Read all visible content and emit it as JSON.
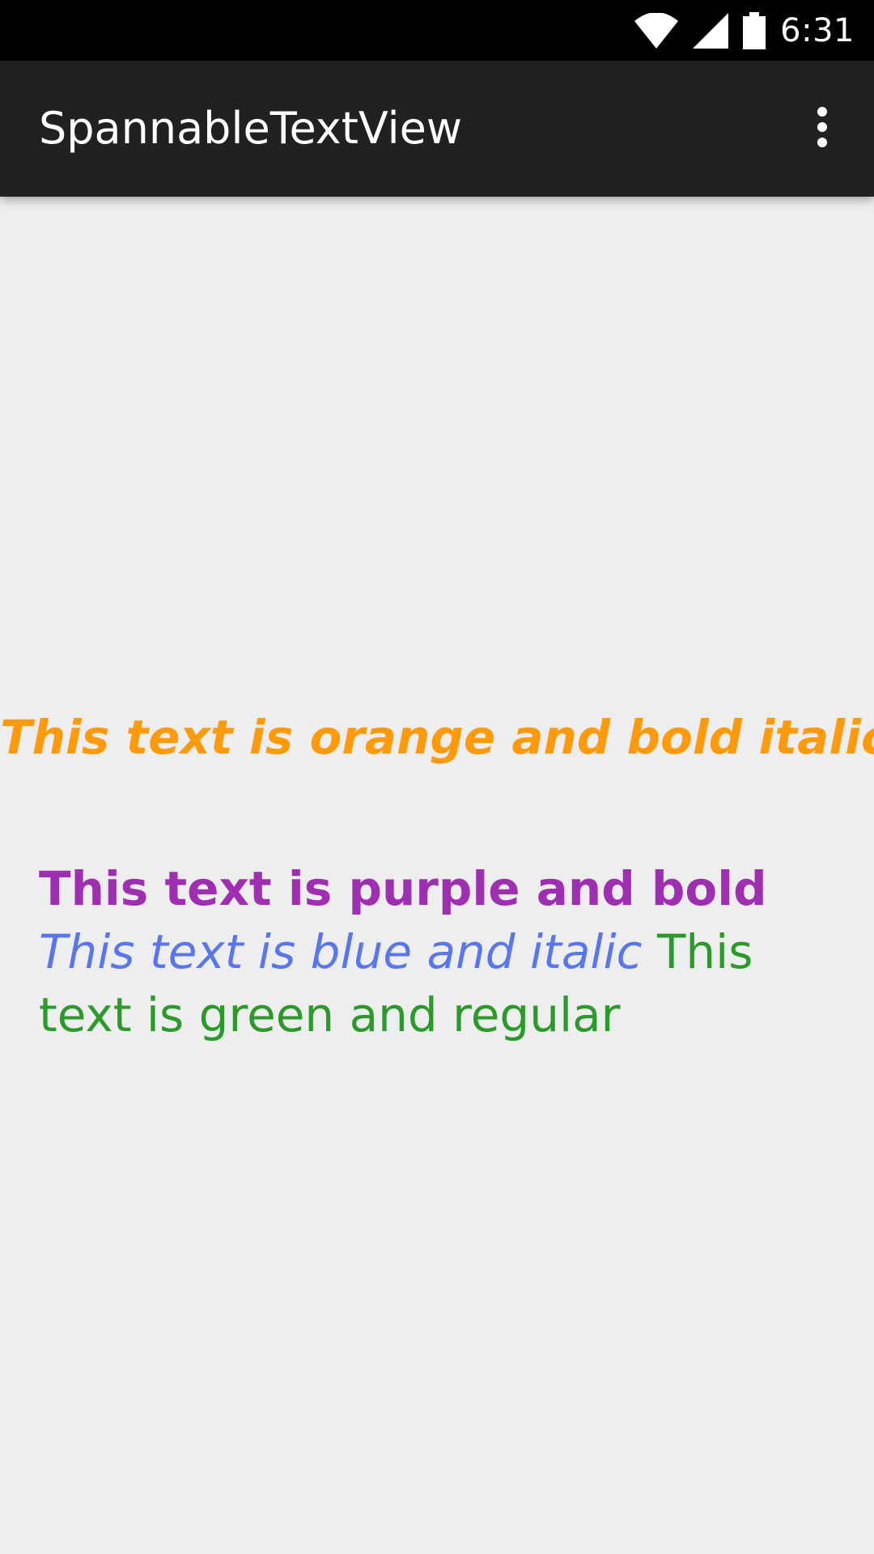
{
  "status_bar": {
    "time": "6:31",
    "icons": [
      "wifi-icon",
      "cell-signal-icon",
      "battery-icon"
    ]
  },
  "app_bar": {
    "title": "SpannableTextView",
    "overflow_icon": "more-vert-icon",
    "background_color": "#212121"
  },
  "content": {
    "orange_text": "This text is orange and bold italic",
    "purple_text": "This text is purple and bold",
    "blue_text": "This text is blue and italic",
    "green_text": "This text is green and regular"
  },
  "colors": {
    "orange": "#ff9a0c",
    "purple": "#9e2fb1",
    "blue": "#5a76ec",
    "green": "#2b9a2b",
    "background": "#eeeeef"
  }
}
